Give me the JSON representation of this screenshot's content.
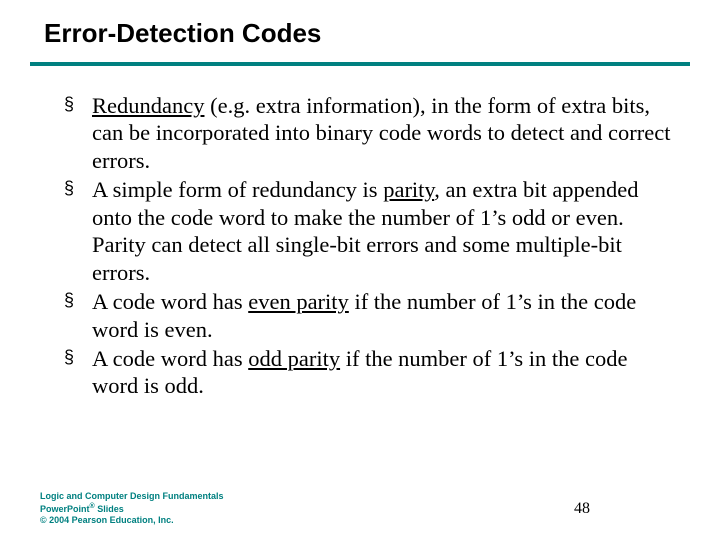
{
  "title": "Error-Detection Codes",
  "bullets": [
    {
      "pre": "",
      "u1": "Redundancy",
      "mid": " (e.g. extra information), in the form of extra bits, can be incorporated into binary code words to detect and correct errors.",
      "u2": "",
      "post": ""
    },
    {
      "pre": "A simple form of redundancy is ",
      "u1": "parity",
      "mid": ", an extra bit appended onto the code word to make the number of 1’s odd or even. Parity can detect all single-bit errors and some multiple-bit errors.",
      "u2": "",
      "post": ""
    },
    {
      "pre": "A code word has ",
      "u1": "even parity",
      "mid": " if the number of 1’s in the code word is even.",
      "u2": "",
      "post": ""
    },
    {
      "pre": "A code word has ",
      "u1": "odd parity",
      "mid": " if the number of 1’s in the code word is odd.",
      "u2": "",
      "post": ""
    }
  ],
  "footer": {
    "line1": "Logic and Computer Design Fundamentals",
    "line2_a": "PowerPoint",
    "line2_b": " Slides",
    "line3": "© 2004 Pearson Education, Inc."
  },
  "page": "48",
  "bullet_char": "§"
}
